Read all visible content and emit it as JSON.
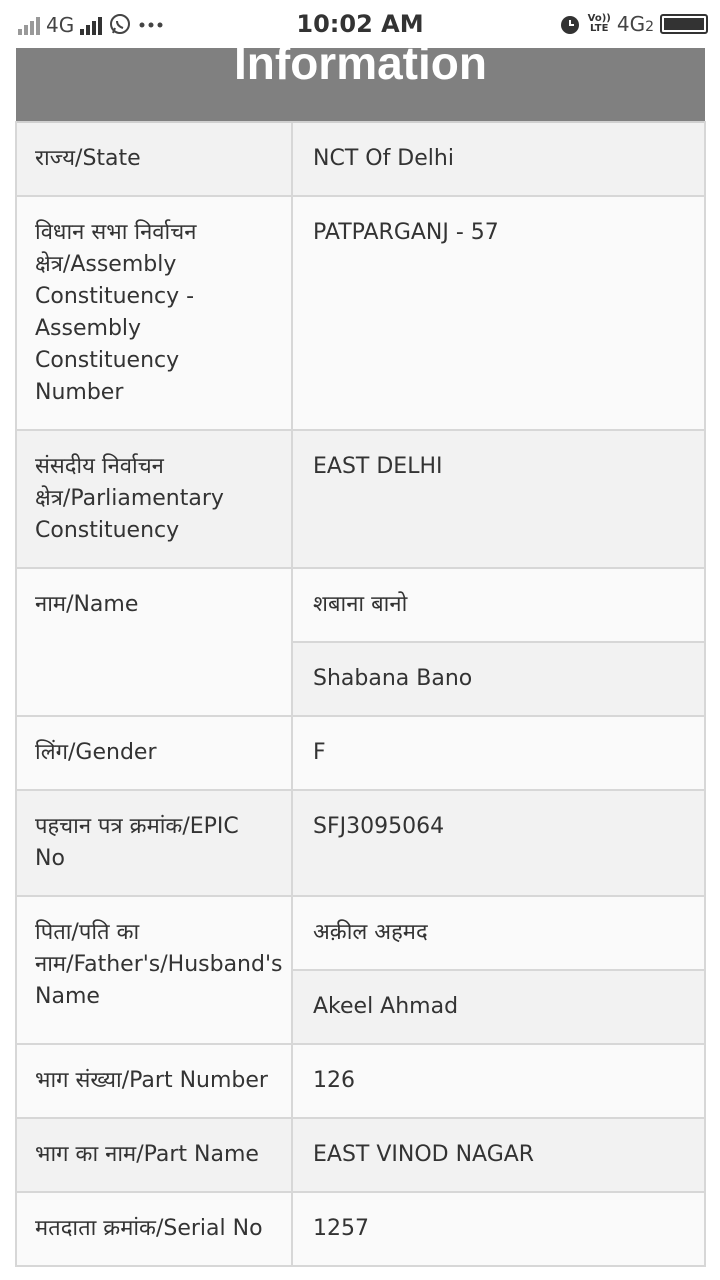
{
  "status_bar": {
    "network": "4G",
    "time": "10:02 AM",
    "volte_line1": "Vo))",
    "volte_line2": "LTE",
    "network2": "4G",
    "sim_number": "2"
  },
  "header": {
    "title": "Information"
  },
  "rows": [
    {
      "label": "राज्य/State",
      "value": "NCT Of Delhi"
    },
    {
      "label": "विधान सभा निर्वाचन क्षेत्र/Assembly Constituency - Assembly Constituency Number",
      "value": "PATPARGANJ - 57"
    },
    {
      "label": "संसदीय निर्वाचन क्षेत्र/Parliamentary Constituency",
      "value": "EAST DELHI"
    },
    {
      "label": "नाम/Name",
      "value_local": "शबाना बानो",
      "value_en": "Shabana Bano"
    },
    {
      "label": "लिंग/Gender",
      "value": "F"
    },
    {
      "label": "पहचान पत्र क्रमांक/EPIC No",
      "value": "SFJ3095064"
    },
    {
      "label": "पिता/पति का नाम/Father's/Husband's Name",
      "value_local": "अक़ील अहमद",
      "value_en": "Akeel Ahmad"
    },
    {
      "label": "भाग संख्या/Part Number",
      "value": "126"
    },
    {
      "label": "भाग का नाम/Part Name",
      "value": "EAST VINOD NAGAR"
    },
    {
      "label": "मतदाता क्रमांक/Serial No",
      "value": "1257"
    }
  ]
}
